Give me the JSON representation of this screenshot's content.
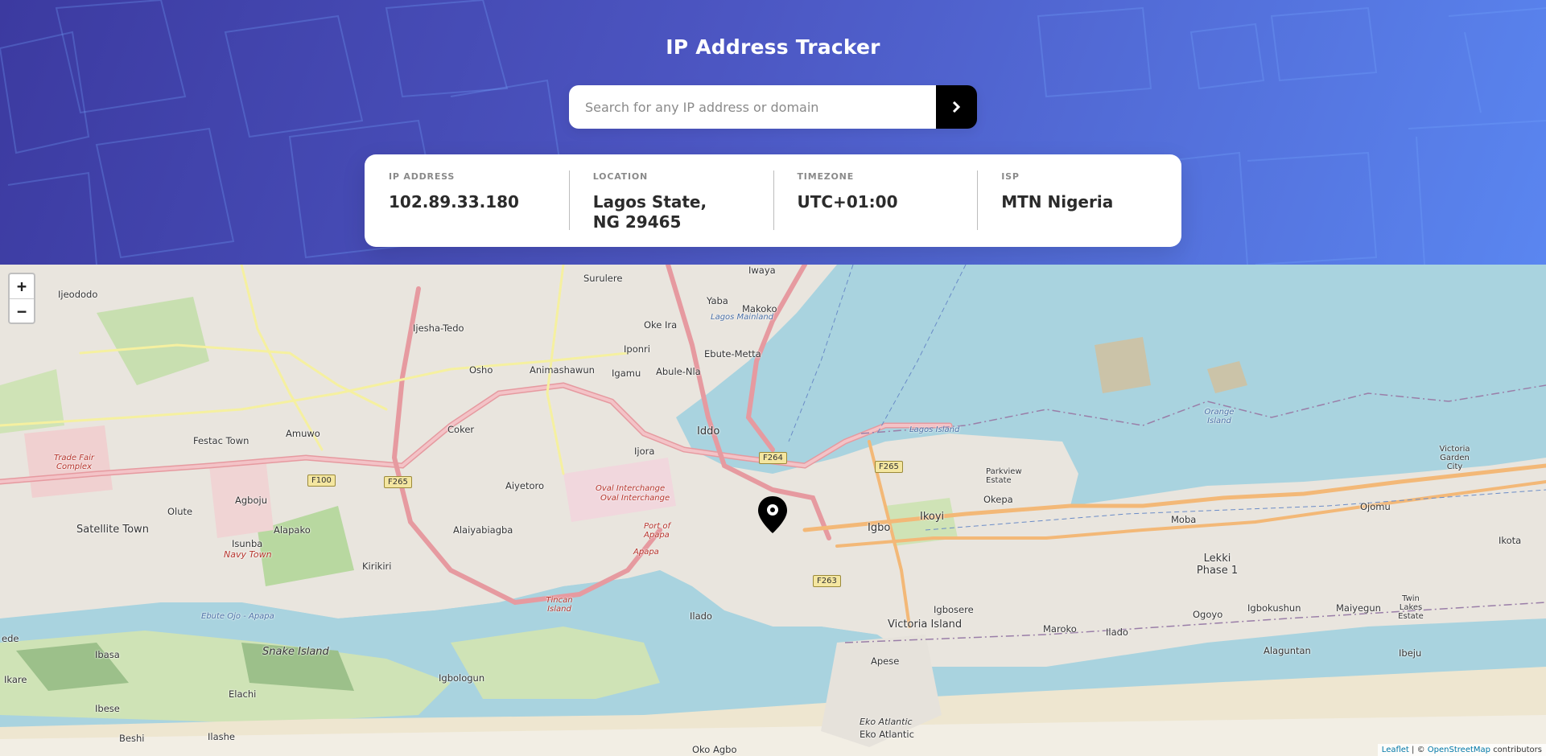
{
  "header": {
    "title": "IP Address Tracker",
    "search_placeholder": "Search for any IP address or domain",
    "search_value": ""
  },
  "info": {
    "ip": {
      "label": "IP ADDRESS",
      "value": "102.89.33.180"
    },
    "location": {
      "label": "LOCATION",
      "line1": "Lagos State,",
      "line2": "NG 29465"
    },
    "timezone": {
      "label": "TIMEZONE",
      "value": "UTC+01:00"
    },
    "isp": {
      "label": "ISP",
      "value": "MTN Nigeria"
    }
  },
  "map": {
    "zoom_in": "+",
    "zoom_out": "−",
    "attribution": {
      "leaflet": "Leaflet",
      "sep": "| ©",
      "osm": "OpenStreetMap",
      "suffix": "contributors"
    },
    "places": {
      "iwaya": "Iwaya",
      "surulere": "Surulere",
      "ijeododo": "Ijeododo",
      "yaba": "Yaba",
      "makoko": "Makoko",
      "ijesha_tedo": "Ijesha-Tedo",
      "oke_ira": "Oke Ira",
      "iponri": "Iponri",
      "ebute_metta": "Ebute-Metta",
      "osho": "Osho",
      "animashawun": "Animashawun",
      "igamu": "Igamu",
      "abule_nla": "Abule-Nla",
      "amuwo": "Amuwo",
      "festac": "Festac Town",
      "coker": "Coker",
      "iddo": "Iddo",
      "ijora": "Ijora",
      "orange_island": "Orange Island",
      "parkview": "Parkview Estate",
      "victoria_garden": "Victoria Garden City",
      "agboju": "Agboju",
      "olute": "Olute",
      "aiyetoro": "Aiyetoro",
      "okepa": "Okepa",
      "ikoyi": "Ikoyi",
      "igbo": "Igbo",
      "satellite": "Satellite Town",
      "isunba": "Isunba",
      "navy_town": "Navy Town",
      "alapako": "Alapako",
      "alaiyabiagba": "Alaiyabiagba",
      "port_apapa": "Port of Apapa",
      "apapa": "Apapa",
      "moba": "Moba",
      "ojomu": "Ojomu",
      "lekki1": "Lekki Phase 1",
      "ikota": "Ikota",
      "kirikiri": "Kirikiri",
      "igbosere": "Igbosere",
      "victoria_island": "Victoria Island",
      "maroko": "Maroko",
      "ilado": "Ilado",
      "ogoyo": "Ogoyo",
      "igbokushun": "Igbokushun",
      "maiyegun": "Maiyegun",
      "twin_lakes": "Twin Lakes Estate",
      "trade_fair": "Trade Fair Complex",
      "oval1": "Oval Interchange",
      "oval2": "Oval Interchange",
      "tincan": "Tincan Island",
      "ilado2": "Ilado",
      "snake_island": "Snake Island",
      "ibasa": "Ibasa",
      "ikare": "Ikare",
      "ibese": "Ibese",
      "elachi": "Elachi",
      "igbologun": "Igbologun",
      "beshi": "Beshi",
      "ilashe": "Ilashe",
      "apese": "Apese",
      "eko_atlantic": "Eko Atlantic",
      "eko_atlantic2": "Eko Atlantic",
      "alaguntan": "Alaguntan",
      "ibeju": "Ibeju",
      "oko_agbo": "Oko Agbo",
      "ede": "ede",
      "lagos_island": "Lagos Island",
      "lagos_mainland": "Lagos Mainland",
      "ebute_ojo": "Ebute Ojo - Apapa"
    },
    "shields": {
      "f100": "F100",
      "f265a": "F265",
      "f264": "F264",
      "f265b": "F265",
      "f263": "F263"
    }
  }
}
